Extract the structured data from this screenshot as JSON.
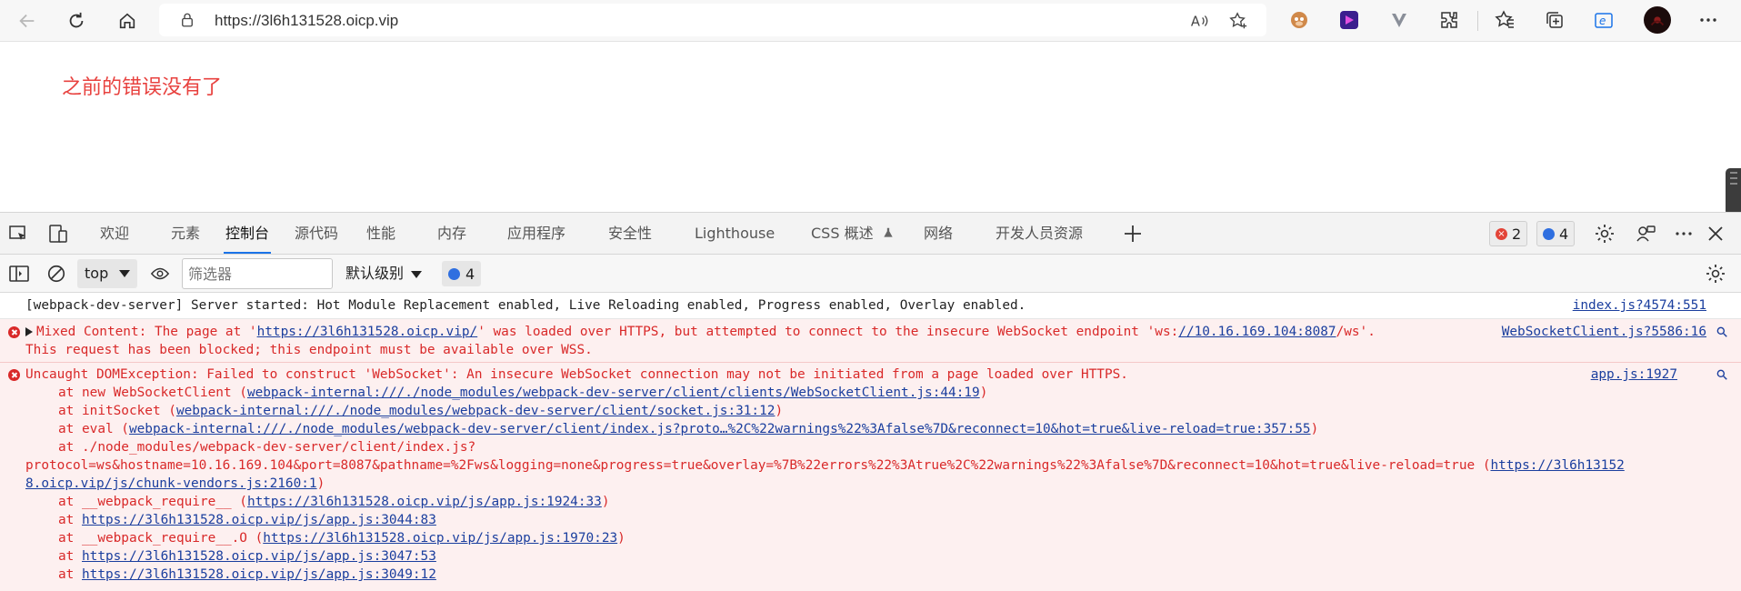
{
  "browser": {
    "url": "https://3l6h131528.oicp.vip",
    "colors": {
      "accent": "#1a73e8",
      "error": "#d92929"
    }
  },
  "page": {
    "message": "之前的错误没有了"
  },
  "devtools": {
    "tabs": [
      {
        "label": "欢迎"
      },
      {
        "label": "元素"
      },
      {
        "label": "控制台",
        "active": true
      },
      {
        "label": "源代码"
      },
      {
        "label": "性能"
      },
      {
        "label": "内存"
      },
      {
        "label": "应用程序"
      },
      {
        "label": "安全性"
      },
      {
        "label": "Lighthouse"
      },
      {
        "label": "CSS 概述"
      },
      {
        "label": "网络"
      },
      {
        "label": "开发人员资源"
      }
    ],
    "error_count": "2",
    "message_count": "4"
  },
  "console_toolbar": {
    "context": "top",
    "filter_placeholder": "筛选器",
    "level": "默认级别",
    "messages": "4"
  },
  "console": {
    "info": {
      "text": "[webpack-dev-server] Server started: Hot Module Replacement enabled, Live Reloading enabled, Progress enabled, Overlay enabled.",
      "source": "index.js?4574:551"
    },
    "mixed": {
      "pre": "Mixed Content: The page at '",
      "link1": "https://3l6h131528.oicp.vip/",
      "mid": "' was loaded over HTTPS, but attempted to connect to the insecure WebSocket endpoint 'ws:",
      "link2": "//10.16.169.104:8087",
      "post": "/ws'.",
      "line2": "This request has been blocked; this endpoint must be available over WSS.",
      "source": "WebSocketClient.js?5586:16"
    },
    "uncaught": {
      "text": "Uncaught DOMException: Failed to construct 'WebSocket': An insecure WebSocket connection may not be initiated from a page loaded over HTTPS.",
      "source": "app.js:1927",
      "s1_pre": "at new WebSocketClient (",
      "s1_link": "webpack-internal:///./node_modules/webpack-dev-server/client/clients/WebSocketClient.js:44:19",
      "s2_pre": "at initSocket (",
      "s2_link": "webpack-internal:///./node_modules/webpack-dev-server/client/socket.js:31:12",
      "s3_pre": "at eval (",
      "s3_link": "webpack-internal:///./node_modules/webpack-dev-server/client/index.js?proto…%2C%22warnings%22%3Afalse%7D&reconnect=10&hot=true&live-reload=true:357:55",
      "s4": "at ./node_modules/webpack-dev-server/client/index.js?",
      "s4_cont": "protocol=ws&hostname=10.16.169.104&port=8087&pathname=%2Fws&logging=none&progress=true&overlay=%7B%22errors%22%3Atrue%2C%22warnings%22%3Afalse%7D&reconnect=10&hot=true&live-reload=true (",
      "s4_link_a": "https://3l6h13152",
      "s4_link_b": "8.oicp.vip/js/chunk-vendors.js:2160:1",
      "s5_pre": "at __webpack_require__ (",
      "s5_link": "https://3l6h131528.oicp.vip/js/app.js:1924:33",
      "s6_pre": "at ",
      "s6_link": "https://3l6h131528.oicp.vip/js/app.js:3044:83",
      "s7_pre": "at __webpack_require__.O (",
      "s7_link": "https://3l6h131528.oicp.vip/js/app.js:1970:23",
      "s8_pre": "at ",
      "s8_link": "https://3l6h131528.oicp.vip/js/app.js:3047:53",
      "s9_pre": "at ",
      "s9_link": "https://3l6h131528.oicp.vip/js/app.js:3049:12"
    }
  }
}
